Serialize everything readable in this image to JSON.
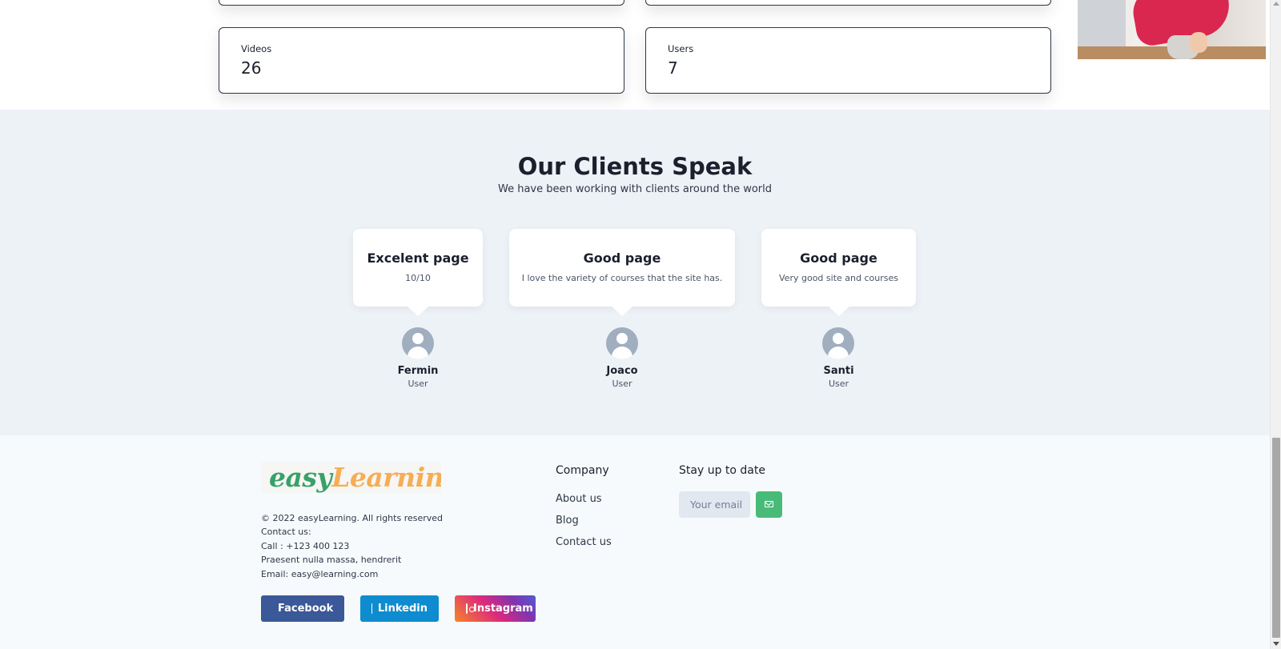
{
  "stats": [
    {
      "label": "Videos",
      "value": "26"
    },
    {
      "label": "Users",
      "value": "7"
    }
  ],
  "clients": {
    "title": "Our Clients Speak",
    "subtitle": "We have been working with clients around the world",
    "testimonials": [
      {
        "title": "Excelent page",
        "text": "10/10",
        "name": "Fermin",
        "role": "User"
      },
      {
        "title": "Good page",
        "text": "I love the variety of courses that the site has.",
        "name": "Joaco",
        "role": "User"
      },
      {
        "title": "Good page",
        "text": "Very good site and courses",
        "name": "Santi",
        "role": "User"
      }
    ]
  },
  "footer": {
    "logo": {
      "part1": "easy",
      "part2": "Learning"
    },
    "info": [
      "© 2022 easyLearning. All rights reserved",
      "Contact us:",
      "Call : +123 400 123",
      "Praesent nulla massa, hendrerit",
      "Email: easy@learning.com"
    ],
    "social": {
      "facebook": "Facebook",
      "linkedin": "Linkedin",
      "instagram": "Instagram"
    },
    "company": {
      "heading": "Company",
      "links": [
        "About us",
        "Blog",
        "Contact us"
      ]
    },
    "newsletter": {
      "heading": "Stay up to date",
      "placeholder": "Your email"
    }
  },
  "colors": {
    "section_bg": "#edf2f7",
    "footer_bg": "#f7fafc",
    "accent_green": "#48bb78",
    "facebook": "#3b5998",
    "linkedin": "#0e8ccf"
  },
  "icons": [
    "user-avatar-icon",
    "facebook-icon",
    "linkedin-icon",
    "instagram-icon",
    "send-mail-icon"
  ]
}
